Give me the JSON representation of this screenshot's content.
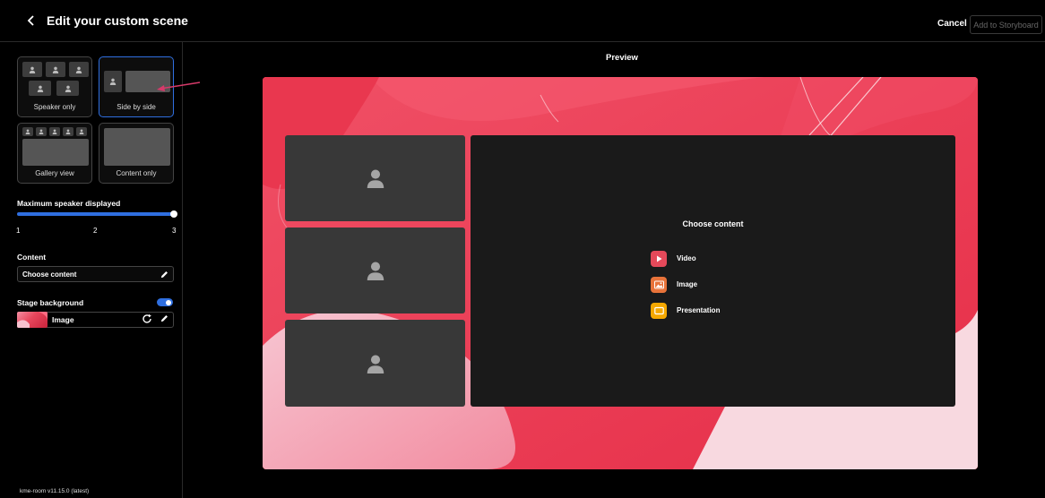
{
  "header": {
    "title": "Edit your custom scene",
    "cancel_label": "Cancel",
    "add_label": "Add to Storyboard"
  },
  "sidebar": {
    "layouts": [
      {
        "label": "Speaker only",
        "selected": false
      },
      {
        "label": "Side by side",
        "selected": true
      },
      {
        "label": "Gallery view",
        "selected": false
      },
      {
        "label": "Content only",
        "selected": false
      }
    ],
    "max_speaker": {
      "label": "Maximum speaker displayed",
      "ticks": [
        "1",
        "2",
        "3"
      ],
      "value": 3
    },
    "content": {
      "label": "Content",
      "value": "Choose content"
    },
    "stage_background": {
      "label": "Stage background",
      "enabled": true,
      "value": "Image"
    },
    "version": "kme-room v11.15.0 (latest)"
  },
  "preview": {
    "title": "Preview",
    "content_title": "Choose content",
    "options": [
      {
        "label": "Video",
        "icon": "play-icon",
        "color": "#e5495a"
      },
      {
        "label": "Image",
        "icon": "image-icon",
        "color": "#e8733a"
      },
      {
        "label": "Presentation",
        "icon": "presentation-icon",
        "color": "#f5a800"
      }
    ]
  },
  "colors": {
    "accent": "#2f6fe0",
    "stage": "#f2384f",
    "arrow": "#d63a6a"
  }
}
